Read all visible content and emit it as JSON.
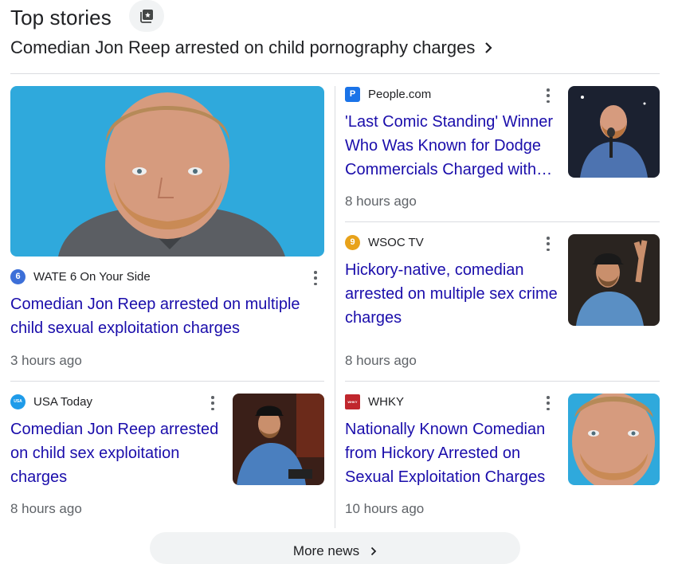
{
  "header": {
    "title": "Top stories"
  },
  "topic": {
    "title": "Comedian Jon Reep arrested on child pornography charges"
  },
  "stories": [
    {
      "source": "WATE 6 On Your Side",
      "logo_text": "6",
      "logo_color": "#3c6fd8",
      "headline": "Comedian Jon Reep arrested on multiple child sexual exploitation charges",
      "time": "3 hours ago"
    },
    {
      "source": "People.com",
      "logo_text": "P",
      "logo_color": "#1a73e8",
      "headline": "'Last Comic Standing' Winner Who Was Known for Dodge Commercials Charged with Multiple Sex Crimes",
      "time": "8 hours ago"
    },
    {
      "source": "WSOC TV",
      "logo_text": "9",
      "logo_color": "#e8a21a",
      "headline": "Hickory-native, comedian arrested on multiple sex crime charges",
      "time": "8 hours ago"
    },
    {
      "source": "USA Today",
      "logo_text": "USA",
      "logo_color": "#1e9be9",
      "headline": "Comedian Jon Reep arrested on child sex exploitation charges",
      "time": "8 hours ago"
    },
    {
      "source": "WHKY",
      "logo_text": "WHKY",
      "logo_color": "#c0262d",
      "headline": "Nationally Known Comedian from Hickory Arrested on Sexual Exploitation Charges",
      "time": "10 hours ago"
    }
  ],
  "more": {
    "label": "More news"
  }
}
